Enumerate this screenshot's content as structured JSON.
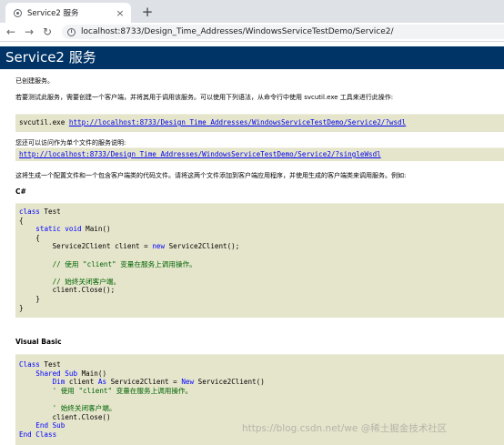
{
  "browser": {
    "tab_title": "Service2 服务",
    "tab_close": "×",
    "new_tab": "+",
    "back": "←",
    "forward": "→",
    "reload": "↻",
    "url": "localhost:8733/Design_Time_Addresses/WindowsServiceTestDemo/Service2/"
  },
  "page": {
    "heading": "Service2 服务",
    "created": "已创建服务。",
    "test_instructions": "若要测试此服务，需要创建一个客户端，并将其用于调用该服务。可以使用下列语法，从命令行中使用 svcutil.exe 工具来进行此操作:",
    "svcutil_cmd": "svcutil.exe ",
    "wsdl_url": "http://localhost:8733/Design_Time_Addresses/WindowsServiceTestDemo/Service2/?wsdl",
    "single_file_text": "您还可以访问作为单个文件的服务说明:",
    "single_wsdl_url": "http://localhost:8733/Design_Time_Addresses/WindowsServiceTestDemo/Service2/?singleWsdl",
    "generate_text": "这将生成一个配置文件和一个包含客户端类的代码文件。请将这两个文件添加到客户端应用程序，并使用生成的客户端类来调用服务。例如:",
    "csharp_heading": "C#",
    "vb_heading": "Visual Basic",
    "csharp_code": [
      [
        {
          "t": "kw",
          "v": "class"
        },
        {
          "t": "",
          "v": " Test"
        }
      ],
      [
        {
          "t": "",
          "v": "{"
        }
      ],
      [
        {
          "t": "",
          "v": "    "
        },
        {
          "t": "kw",
          "v": "static void"
        },
        {
          "t": "",
          "v": " Main()"
        }
      ],
      [
        {
          "t": "",
          "v": "    {"
        }
      ],
      [
        {
          "t": "",
          "v": "        Service2Client client = "
        },
        {
          "t": "kw",
          "v": "new"
        },
        {
          "t": "",
          "v": " Service2Client();"
        }
      ],
      [
        {
          "t": "",
          "v": ""
        }
      ],
      [
        {
          "t": "cm",
          "v": "        // 使用 \"client\" 变量在服务上调用操作。"
        }
      ],
      [
        {
          "t": "",
          "v": ""
        }
      ],
      [
        {
          "t": "cm",
          "v": "        // 始终关闭客户端。"
        }
      ],
      [
        {
          "t": "",
          "v": "        client.Close();"
        }
      ],
      [
        {
          "t": "",
          "v": "    }"
        }
      ],
      [
        {
          "t": "",
          "v": "}"
        }
      ]
    ],
    "vb_code": [
      [
        {
          "t": "kw",
          "v": "Class"
        },
        {
          "t": "",
          "v": " Test"
        }
      ],
      [
        {
          "t": "",
          "v": "    "
        },
        {
          "t": "kw",
          "v": "Shared Sub"
        },
        {
          "t": "",
          "v": " Main()"
        }
      ],
      [
        {
          "t": "",
          "v": "        "
        },
        {
          "t": "kw",
          "v": "Dim"
        },
        {
          "t": "",
          "v": " client "
        },
        {
          "t": "kw",
          "v": "As"
        },
        {
          "t": "",
          "v": " Service2Client = "
        },
        {
          "t": "kw",
          "v": "New"
        },
        {
          "t": "",
          "v": " Service2Client()"
        }
      ],
      [
        {
          "t": "cm",
          "v": "        ' 使用 \"client\" 变量在服务上调用操作。"
        }
      ],
      [
        {
          "t": "",
          "v": ""
        }
      ],
      [
        {
          "t": "cm",
          "v": "        ' 始终关闭客户端。"
        }
      ],
      [
        {
          "t": "",
          "v": "        client.Close()"
        }
      ],
      [
        {
          "t": "",
          "v": "    "
        },
        {
          "t": "kw",
          "v": "End Sub"
        }
      ],
      [
        {
          "t": "kw",
          "v": "End Class"
        }
      ]
    ],
    "watermark": "https://blog.csdn.net/we @稀土掘金技术社区"
  },
  "colors": {
    "heading_bg": "#003366",
    "code_bg": "#e5e5cc",
    "link": "#0000ee",
    "keyword": "#0000ff",
    "comment": "#006400"
  }
}
